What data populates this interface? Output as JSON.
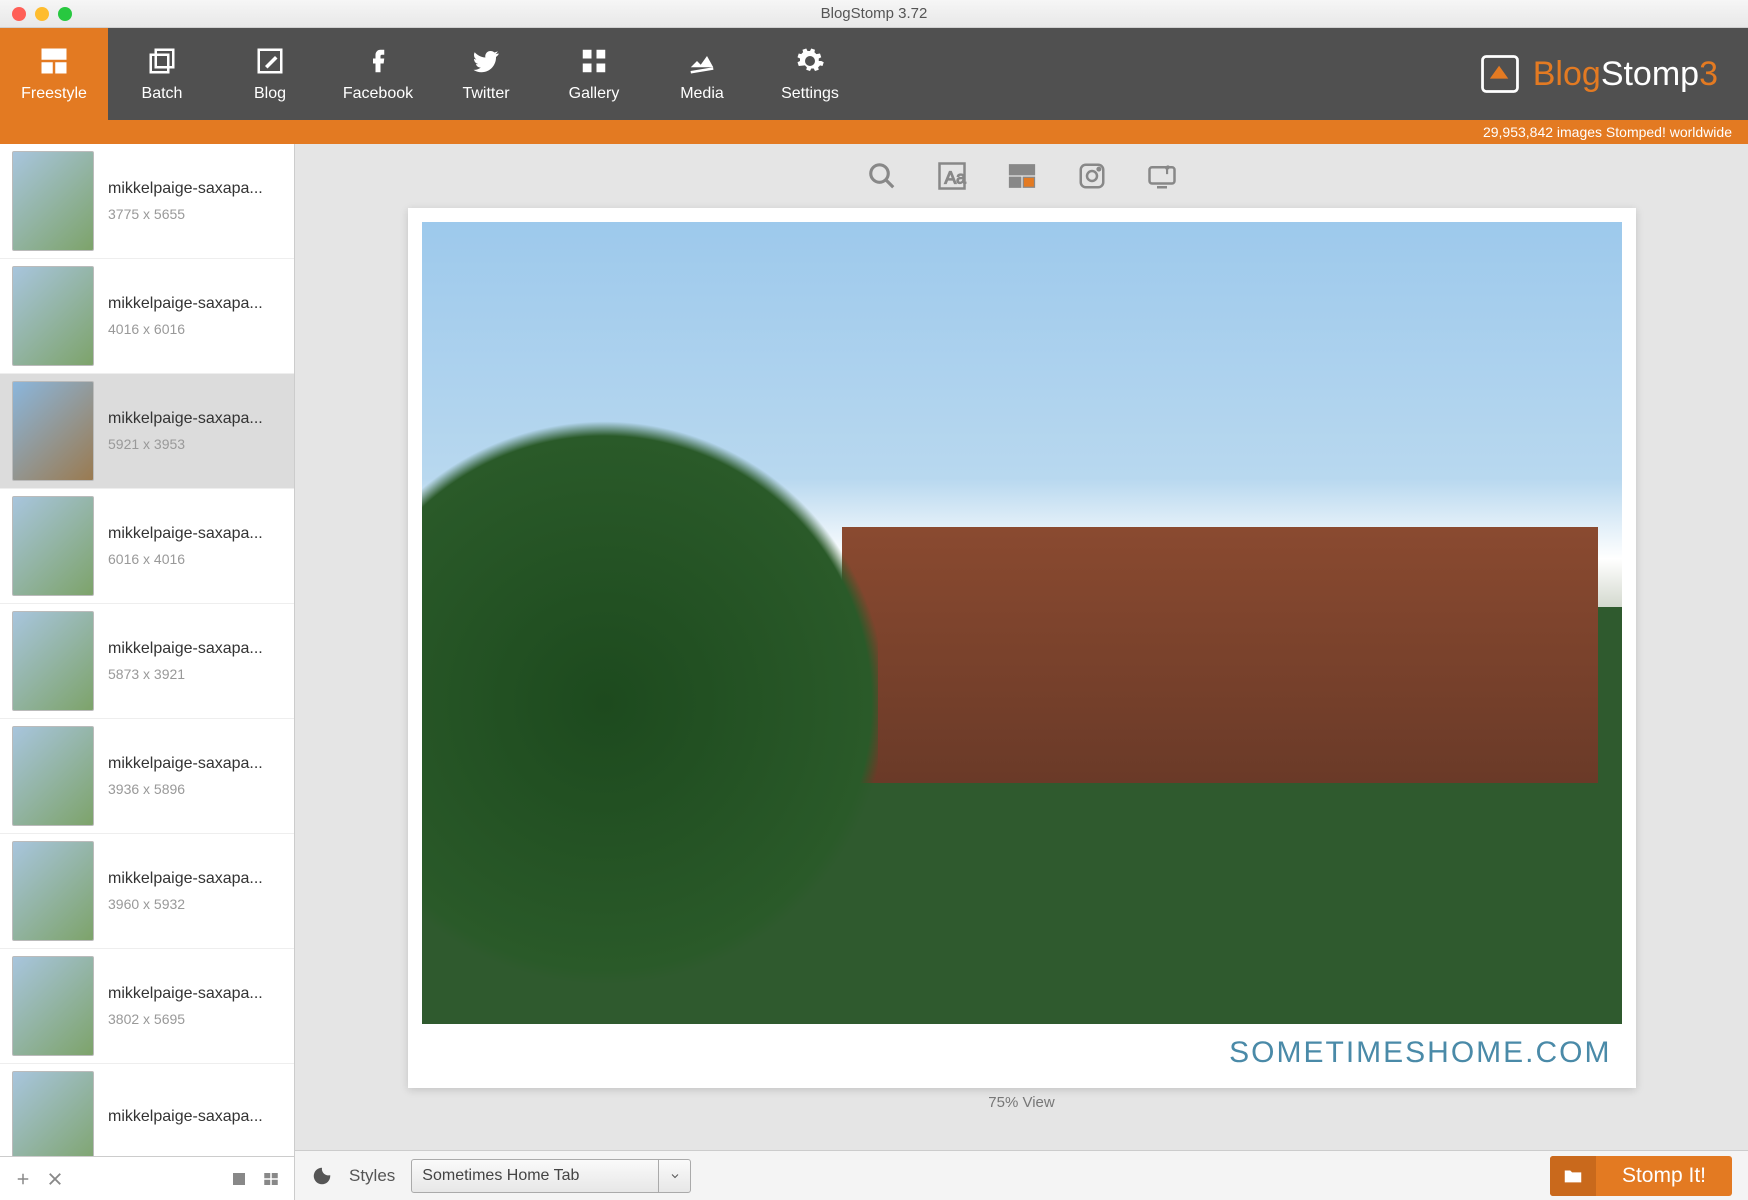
{
  "window_title": "BlogStomp 3.72",
  "toolbar": [
    {
      "id": "freestyle",
      "label": "Freestyle",
      "active": true
    },
    {
      "id": "batch",
      "label": "Batch",
      "active": false
    },
    {
      "id": "blog",
      "label": "Blog",
      "active": false
    },
    {
      "id": "facebook",
      "label": "Facebook",
      "active": false
    },
    {
      "id": "twitter",
      "label": "Twitter",
      "active": false
    },
    {
      "id": "gallery",
      "label": "Gallery",
      "active": false
    },
    {
      "id": "media",
      "label": "Media",
      "active": false
    },
    {
      "id": "settings",
      "label": "Settings",
      "active": false
    }
  ],
  "brand": {
    "part1": "Blog",
    "part2": "Stomp",
    "part3": "3"
  },
  "stats_strip": "29,953,842 images Stomped! worldwide",
  "thumbs": [
    {
      "name": "mikkelpaige-saxapa...",
      "dims": "3775 x 5655",
      "selected": false
    },
    {
      "name": "mikkelpaige-saxapa...",
      "dims": "4016 x 6016",
      "selected": false
    },
    {
      "name": "mikkelpaige-saxapa...",
      "dims": "5921 x 3953",
      "selected": true
    },
    {
      "name": "mikkelpaige-saxapa...",
      "dims": "6016 x 4016",
      "selected": false
    },
    {
      "name": "mikkelpaige-saxapa...",
      "dims": "5873 x 3921",
      "selected": false
    },
    {
      "name": "mikkelpaige-saxapa...",
      "dims": "3936 x 5896",
      "selected": false
    },
    {
      "name": "mikkelpaige-saxapa...",
      "dims": "3960 x 5932",
      "selected": false
    },
    {
      "name": "mikkelpaige-saxapa...",
      "dims": "3802 x 5695",
      "selected": false
    },
    {
      "name": "mikkelpaige-saxapa...",
      "dims": "",
      "selected": false
    }
  ],
  "watermark": "SOMETIMESHOME.COM",
  "view_label": "75% View",
  "footer": {
    "styles_label": "Styles",
    "style_selected": "Sometimes Home Tab",
    "stomp_label": "Stomp It!"
  }
}
